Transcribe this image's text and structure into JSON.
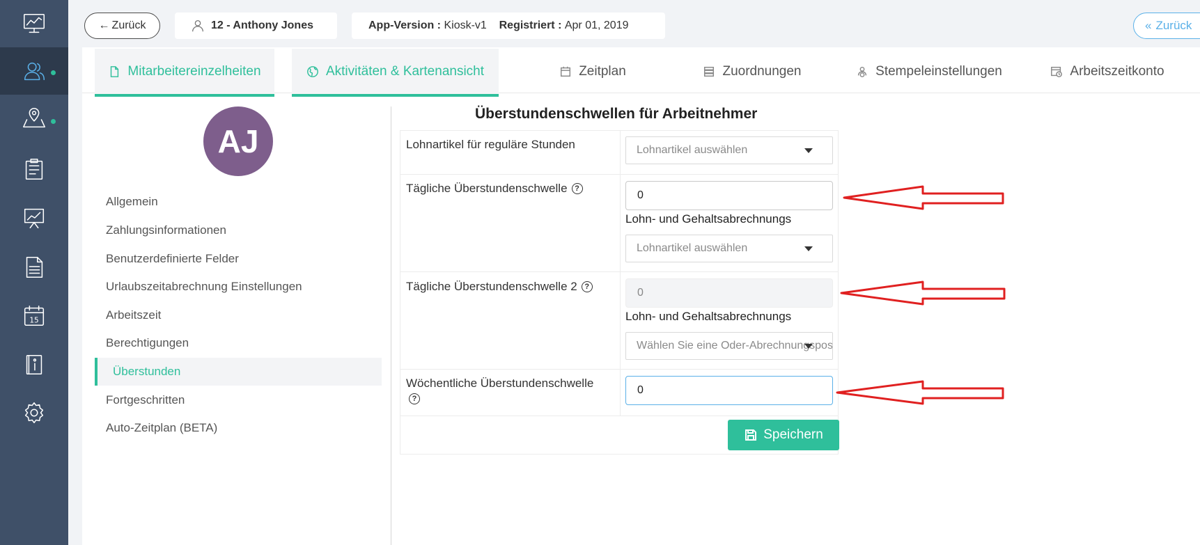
{
  "topbar": {
    "back_label": "Zurück",
    "employee": "12 - Anthony Jones",
    "app_version_label": "App-Version :",
    "app_version_value": "Kiosk-v1",
    "registered_label": "Registriert :",
    "registered_value": "Apr 01, 2019",
    "back_right_label": "Zurück"
  },
  "tabs": [
    {
      "label": "Mitarbeitereinzelheiten",
      "icon": "document-icon"
    },
    {
      "label": "Aktivitäten & Kartenansicht",
      "icon": "globe-icon"
    },
    {
      "label": "Zeitplan",
      "icon": "calendar-icon"
    },
    {
      "label": "Zuordnungen",
      "icon": "server-icon"
    },
    {
      "label": "Stempeleinstellungen",
      "icon": "user-stamp-icon"
    },
    {
      "label": "Arbeitszeitkonto",
      "icon": "calendar-clock-icon"
    }
  ],
  "avatar": {
    "initials": "AJ",
    "color": "#7e5e8c"
  },
  "sidebar": {
    "items": [
      {
        "label": "Allgemein"
      },
      {
        "label": "Zahlungsinformationen"
      },
      {
        "label": "Benutzerdefinierte Felder"
      },
      {
        "label": "Urlaubszeitabrechnung Einstellungen"
      },
      {
        "label": "Arbeitszeit"
      },
      {
        "label": "Berechtigungen"
      },
      {
        "label": "Überstunden"
      },
      {
        "label": "Fortgeschritten"
      },
      {
        "label": "Auto-Zeitplan (BETA)"
      }
    ],
    "active_index": 6
  },
  "form": {
    "title": "Überstundenschwellen für Arbeitnehmer",
    "rows": [
      {
        "label": "Lohnartikel für reguläre Stunden",
        "select_placeholder": "Lohnartikel auswählen"
      },
      {
        "label": "Tägliche Überstundenschwelle",
        "help": "?",
        "value": "0",
        "sublabel": "Lohn- und Gehaltsabrechnungs",
        "select_placeholder": "Lohnartikel auswählen"
      },
      {
        "label": "Tägliche Überstundenschwelle 2",
        "help": "?",
        "value": "0",
        "sublabel": "Lohn- und Gehaltsabrechnungs",
        "select_placeholder": "Wählen Sie eine Oder-Abrechnungsposition"
      },
      {
        "label": "Wöchentliche Überstundenschwelle",
        "help": "?",
        "value": "0"
      }
    ],
    "save_label": "Speichern"
  },
  "colors": {
    "rail": "#3f5068",
    "accent": "#2fbf9b",
    "link": "#5ab0e8",
    "annotation": "#e02020"
  }
}
